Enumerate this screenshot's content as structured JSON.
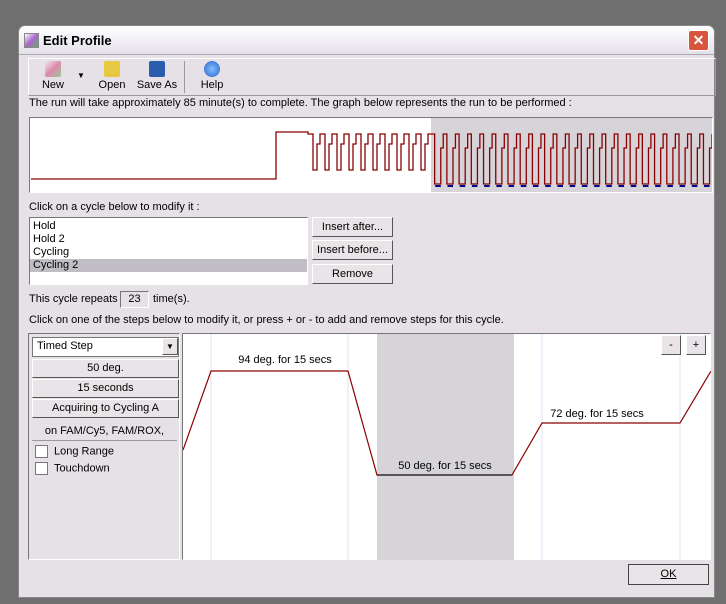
{
  "window": {
    "title": "Edit Profile",
    "close_label": "✕"
  },
  "toolbar": {
    "new": "New",
    "open": "Open",
    "save_as": "Save As",
    "help": "Help"
  },
  "summary": "The run will take approximately 85 minute(s) to complete. The graph below represents the run to be performed :",
  "cycles": {
    "prompt": "Click on a cycle below to modify it :",
    "items": [
      "Hold",
      "Hold 2",
      "Cycling",
      "Cycling 2"
    ],
    "selected": "Cycling 2",
    "insert_after": "Insert after...",
    "insert_before": "Insert before...",
    "remove": "Remove"
  },
  "repeat": {
    "prefix": "This cycle repeats",
    "value": "23",
    "suffix": "time(s)."
  },
  "steps_prompt": "Click on one of the steps below to modify it, or press + or - to add and remove steps for this cycle.",
  "step_editor": {
    "type": "Timed Step",
    "temperature": "50 deg.",
    "duration": "15 seconds",
    "acquiring": "Acquiring to Cycling A",
    "channels": "on FAM/Cy5, FAM/ROX,",
    "long_range": "Long Range",
    "touchdown": "Touchdown"
  },
  "steps": [
    {
      "label": "94 deg. for 15 secs"
    },
    {
      "label": "50 deg. for 15 secs",
      "selected": true
    },
    {
      "label": "72 deg. for 15 secs"
    }
  ],
  "step_buttons": {
    "minus": "-",
    "plus": "+"
  },
  "ok": "OK",
  "colors": {
    "trace": "#8b0000",
    "selection": "#d6d4d8",
    "acquire_marker": "#00008b"
  }
}
